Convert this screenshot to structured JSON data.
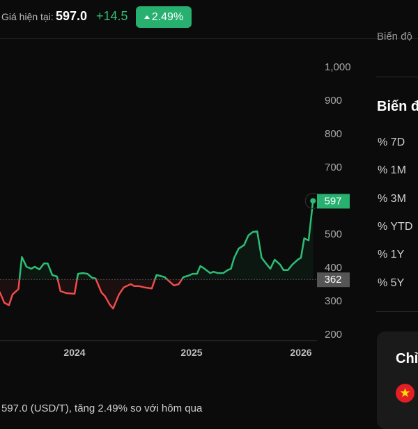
{
  "header": {
    "price_label": "Giá hiện tại:",
    "price_value": "597.0",
    "change": "+14.5",
    "change_pct": "2.49%",
    "up_color": "#27b06f"
  },
  "right_panel": {
    "cut_heading": "Biến độ",
    "heading": "Biến đ",
    "periods": [
      "% 7D",
      "% 1M",
      "% 3M",
      "% YTD",
      "% 1Y",
      "% 5Y"
    ],
    "card_title": "Chỉ",
    "flag_icon": "vietnam-flag-icon"
  },
  "footer": "597.0 (USD/T), tăng 2.49% so với hôm qua",
  "chart_data": {
    "type": "line",
    "x_ticks": [
      "2024",
      "2025",
      "2026"
    ],
    "y_ticks": [
      "200",
      "300",
      "400",
      "500",
      "600",
      "700",
      "800",
      "900",
      "1,000"
    ],
    "ylim": [
      200,
      1000
    ],
    "baseline": 362,
    "baseline_label": "362",
    "last_label": "597",
    "colors": {
      "above": "#2ebd75",
      "below": "#f04b4b",
      "baseline_badge": "#555555"
    },
    "x": [
      2023.36,
      2023.4,
      2023.44,
      2023.47,
      2023.52,
      2023.55,
      2023.59,
      2023.63,
      2023.66,
      2023.7,
      2023.74,
      2023.77,
      2023.81,
      2023.85,
      2023.88,
      2023.93,
      2024.0,
      2024.03,
      2024.07,
      2024.11,
      2024.15,
      2024.18,
      2024.23,
      2024.26,
      2024.3,
      2024.33,
      2024.38,
      2024.42,
      2024.48,
      2024.51,
      2024.55,
      2024.6,
      2024.66,
      2024.7,
      2024.73,
      2024.77,
      2024.81,
      2024.85,
      2024.89,
      2024.93,
      2024.97,
      2025.01,
      2025.05,
      2025.08,
      2025.11,
      2025.17,
      2025.2,
      2025.24,
      2025.29,
      2025.33,
      2025.36,
      2025.39,
      2025.43,
      2025.48,
      2025.52,
      2025.56,
      2025.6,
      2025.64,
      2025.68,
      2025.72,
      2025.76,
      2025.81,
      2025.84,
      2025.88,
      2025.92,
      2025.97,
      2026.0,
      2026.03,
      2026.07,
      2026.11
    ],
    "y": [
      325,
      292,
      285,
      317,
      333,
      429,
      400,
      394,
      400,
      392,
      410,
      410,
      375,
      371,
      327,
      321,
      319,
      379,
      381,
      379,
      367,
      365,
      323,
      312,
      287,
      275,
      317,
      338,
      348,
      342,
      342,
      338,
      335,
      375,
      373,
      369,
      356,
      344,
      348,
      369,
      373,
      379,
      379,
      402,
      396,
      381,
      385,
      381,
      381,
      390,
      394,
      427,
      454,
      465,
      494,
      504,
      506,
      427,
      410,
      394,
      421,
      406,
      390,
      390,
      406,
      421,
      427,
      485,
      479,
      597
    ]
  }
}
